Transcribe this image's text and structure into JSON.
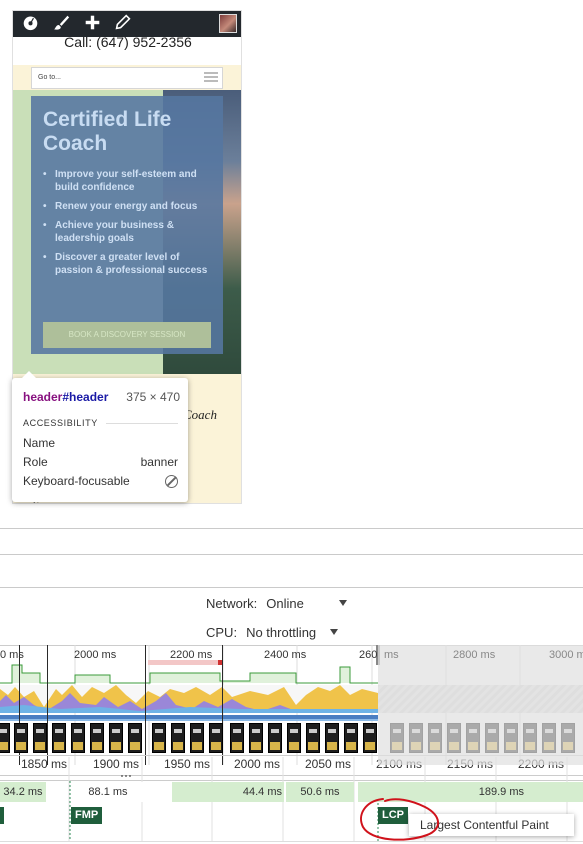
{
  "preview": {
    "admin_bar": {
      "icons": [
        "dashboard-icon",
        "brush-icon",
        "plus-icon",
        "pencil-icon"
      ],
      "avatar": "avatar-image"
    },
    "phone": "Call: (647) 952-2356",
    "menu": {
      "placeholder": "Go to..."
    },
    "hero": {
      "title": "Certified Life Coach",
      "bullets": [
        "Improve your self-esteem and build confidence",
        "Renew your energy and focus",
        "Achieve your business & leadership goals",
        "Discover a greater level of passion & professional success"
      ],
      "cta": "BOOK A DISCOVERY SESSION"
    },
    "peek_text": "Coach",
    "peek_bottom": "e"
  },
  "inspect_tooltip": {
    "tag": "header",
    "id": "#header",
    "dimensions": "375 × 470",
    "section": "ACCESSIBILITY",
    "props": [
      {
        "name": "Name",
        "value": ""
      },
      {
        "name": "Role",
        "value": "banner"
      },
      {
        "name": "Keyboard-focusable",
        "value": "not-allowed-icon"
      }
    ]
  },
  "throttling": {
    "network": {
      "label": "Network:",
      "value": "Online"
    },
    "cpu": {
      "label": "CPU:",
      "value": "No throttling"
    }
  },
  "timeline": {
    "overview_ticks": [
      "0 ms",
      "2000 ms",
      "2200 ms",
      "2400 ms",
      "260",
      "ms",
      "2800 ms",
      "3000 ms"
    ],
    "ruler_ticks": [
      "1850 ms",
      "1900 ms",
      "1950 ms",
      "2000 ms",
      "2050 ms",
      "2100 ms",
      "2150 ms",
      "2200 ms"
    ],
    "timings": [
      "34.2 ms",
      "88.1 ms",
      "44.4 ms",
      "50.6 ms",
      "189.9 ms"
    ],
    "markers": [
      "FMP",
      "LCP"
    ],
    "lcp_tooltip": "Largest Contentful Paint"
  },
  "colors": {
    "admin_bar": "#23282d",
    "hero_panel": "#5576a0",
    "marker_green": "#1f5e3c",
    "timing_green": "#d5edcf",
    "annotation_red": "#d0121b"
  }
}
